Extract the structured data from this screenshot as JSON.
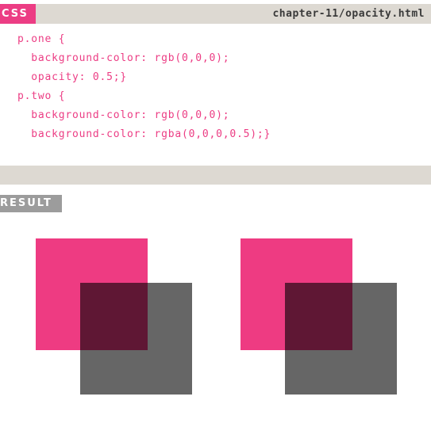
{
  "header": {
    "tag": "CSS",
    "file_path": "chapter-11/opacity.html"
  },
  "code_lines": [
    "p.one {",
    "  background-color: rgb(0,0,0);",
    "  opacity: 0.5;}",
    "p.two {",
    "  background-color: rgb(0,0,0);",
    "  background-color: rgba(0,0,0,0.5);}"
  ],
  "result": {
    "tag": "RESULT"
  },
  "colors": {
    "accent": "#ec3d84",
    "bar": "#ddd9d2",
    "result_tag": "#9c9c9c",
    "square_pink": "#ee3b82"
  }
}
